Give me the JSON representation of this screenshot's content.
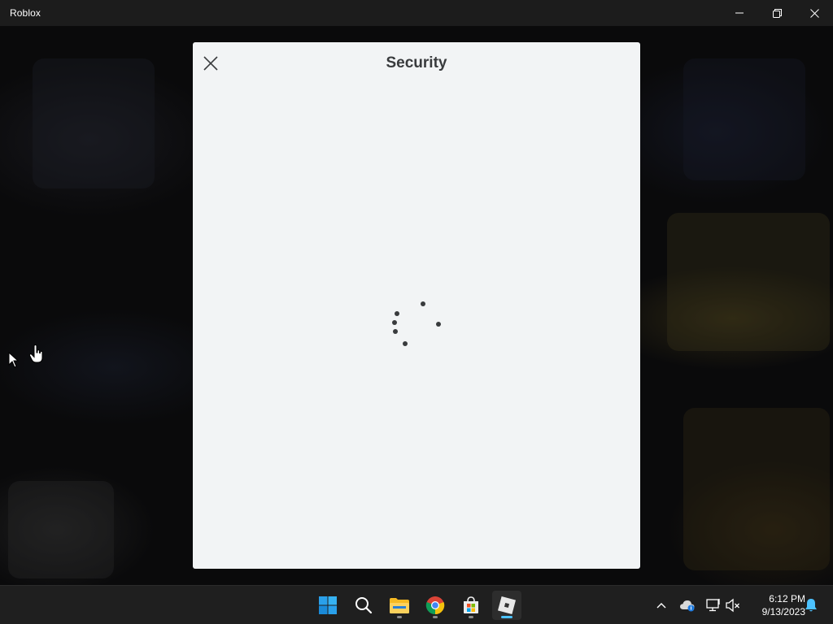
{
  "window": {
    "title": "Roblox"
  },
  "dialog": {
    "title": "Security",
    "loading": true
  },
  "taskbar": {
    "apps": [
      {
        "name": "start",
        "active": false
      },
      {
        "name": "search",
        "active": false
      },
      {
        "name": "file-explorer",
        "active": false,
        "running": true
      },
      {
        "name": "chrome",
        "active": false,
        "running": true
      },
      {
        "name": "microsoft-store",
        "active": false,
        "running": true
      },
      {
        "name": "roblox",
        "active": true,
        "running": true
      }
    ],
    "time": "6:12 PM",
    "date": "9/13/2023"
  },
  "colors": {
    "dialog_bg": "#f2f4f5",
    "heading_text": "#393b3d",
    "titlebar_bg": "#1c1c1c",
    "taskbar_bg": "#1f1f1f",
    "active_indicator": "#4cc2ff"
  }
}
